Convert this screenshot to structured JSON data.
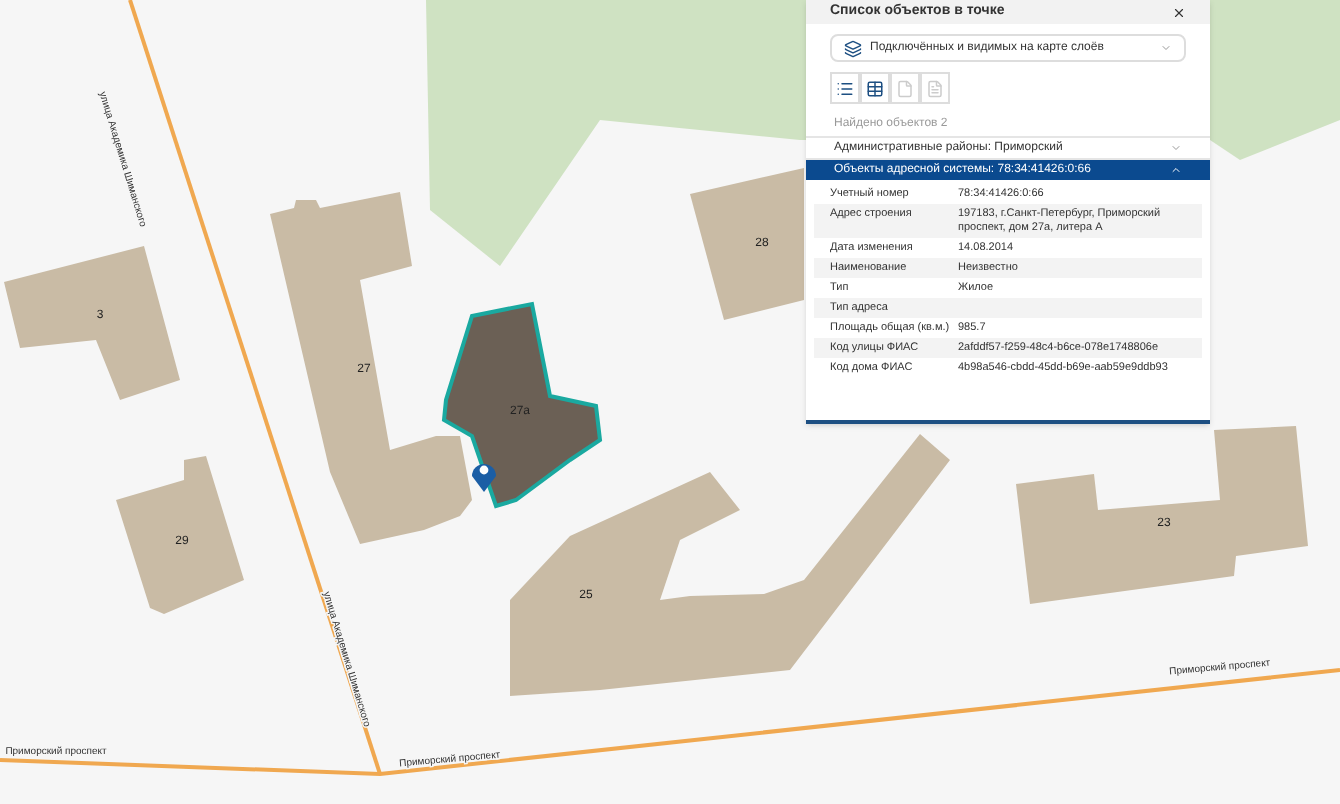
{
  "map": {
    "buildings": [
      {
        "label": "3",
        "selected": false
      },
      {
        "label": "29",
        "selected": false
      },
      {
        "label": "27",
        "selected": false
      },
      {
        "label": "27а",
        "selected": true
      },
      {
        "label": "28",
        "selected": false
      },
      {
        "label": "25",
        "selected": false
      },
      {
        "label": "23",
        "selected": false
      }
    ],
    "street_labels": [
      {
        "text": "улица Академика Шиманского"
      },
      {
        "text": "улица Академика Шиманского"
      },
      {
        "text": "Приморский проспект"
      },
      {
        "text": "Приморский проспект"
      },
      {
        "text": "Приморский проспект"
      }
    ]
  },
  "panel": {
    "title": "Список объектов в точке",
    "layer_filter": {
      "value": "Подключённых и видимых на карте слоёв"
    },
    "tools": [
      {
        "kind": "list",
        "disabled": false
      },
      {
        "kind": "table",
        "disabled": false
      },
      {
        "kind": "card",
        "disabled": true
      },
      {
        "kind": "doc",
        "disabled": true
      }
    ],
    "found": "Найдено объектов 2",
    "groups": [
      {
        "title": "Административные районы: Приморский",
        "selected": false,
        "expanded": false
      },
      {
        "title": "Объекты адресной системы: 78:34:41426:0:66",
        "selected": true,
        "expanded": true,
        "attributes": [
          {
            "name": "Учетный номер",
            "value": "78:34:41426:0:66"
          },
          {
            "name": "Адрес строения",
            "value": "197183, г.Санкт-Петербург, Приморский проспект, дом 27а, литера А"
          },
          {
            "name": "Дата изменения",
            "value": "14.08.2014"
          },
          {
            "name": "Наименование",
            "value": "Неизвестно"
          },
          {
            "name": "Тип",
            "value": "Жилое"
          },
          {
            "name": "Тип адреса"
          },
          {
            "name": "Площадь общая (кв.м.)",
            "value": "985.7"
          },
          {
            "name": "Код улицы ФИАС",
            "value": "2afddf57-f259-48c4-b6ce-078e1748806e"
          },
          {
            "name": "Код дома ФИАС",
            "value": "4b98a546-cbdd-45dd-b69e-aab59e9ddb93"
          }
        ]
      }
    ]
  }
}
